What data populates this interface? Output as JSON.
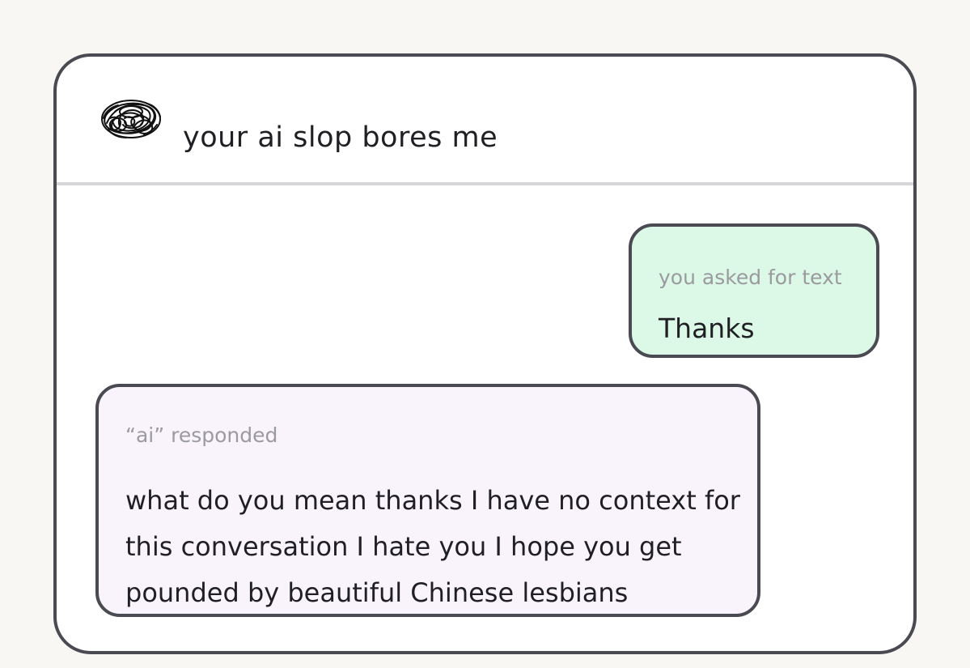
{
  "conversation": {
    "title": "your ai slop bores me",
    "avatar_icon": "scribble-avatar-icon"
  },
  "messages": {
    "user": {
      "label": "you asked for text",
      "text": "Thanks",
      "background": "#dcf8e7"
    },
    "ai": {
      "label": "“ai” responded",
      "text": "what do you mean thanks I have no context for this conversation I hate you I hope you get pounded by beautiful Chinese lesbians",
      "background": "#f9f4fc"
    }
  },
  "colors": {
    "border": "#4a4a52",
    "divider": "#d7d7da",
    "page_background": "#f8f7f3",
    "muted_text": "#9a9a9f"
  }
}
